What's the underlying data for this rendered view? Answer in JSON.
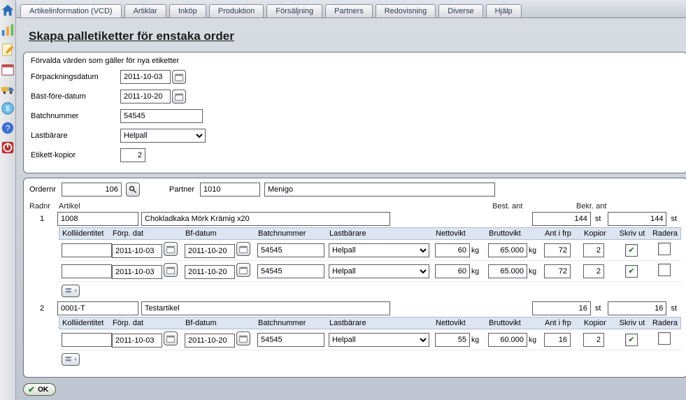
{
  "tabs": [
    "Artikelinformation (VCD)",
    "Artiklar",
    "Inköp",
    "Produktion",
    "Försäljning",
    "Partners",
    "Redovisning",
    "Diverse",
    "Hjälp"
  ],
  "page_title": "Skapa palletiketter för enstaka order",
  "defaults": {
    "caption": "Förvalda värden som gäller för nya etiketter",
    "labels": {
      "forpackningsdatum": "Förpackningsdatum",
      "bast_fore_datum": "Bäst-före-datum",
      "batchnummer": "Batchnummer",
      "lastbarare": "Lastbärare",
      "etikett_kopior": "Etikett-kopior"
    },
    "values": {
      "forpackningsdatum": "2011-10-03",
      "bast_fore_datum": "2011-10-20",
      "batchnummer": "54545",
      "lastbarare": "Helpall",
      "etikett_kopior": "2"
    }
  },
  "order": {
    "labels": {
      "ordernr": "Ordernr",
      "partner": "Partner"
    },
    "ordernr": "106",
    "partner_code": "1010",
    "partner_name": "Menigo"
  },
  "grid": {
    "head": {
      "radnr": "Radnr",
      "artikel": "Artikel",
      "best_ant": "Best. ant",
      "bekr_ant": "Bekr. ant"
    },
    "subhead": {
      "kolliidentitet": "Kolliidentitet",
      "forp_dat": "Förp. dat",
      "bf_datum": "Bf-datum",
      "batchnummer": "Batchnummer",
      "lastbarare": "Lastbärare",
      "nettovikt": "Nettovikt",
      "bruttovikt": "Bruttovikt",
      "ant_i_frp": "Ant i frp",
      "kopior": "Kopior",
      "skriv_ut": "Skriv ut",
      "radera": "Radera"
    },
    "unit_st": "st",
    "unit_kg": "kg",
    "lines": [
      {
        "row": "1",
        "artnr": "1008",
        "artdesc": "Chokladkaka Mörk Krämig x20",
        "best_ant": "144",
        "bekr_ant": "144",
        "subs": [
          {
            "kolli": "",
            "forp": "2011-10-03",
            "bf": "2011-10-20",
            "batch": "54545",
            "last": "Helpall",
            "netto": "60",
            "brutto": "65.000",
            "antfrp": "72",
            "kopior": "2",
            "skriv": true,
            "radera": false
          },
          {
            "kolli": "",
            "forp": "2011-10-03",
            "bf": "2011-10-20",
            "batch": "54545",
            "last": "Helpall",
            "netto": "60",
            "brutto": "65.000",
            "antfrp": "72",
            "kopior": "2",
            "skriv": true,
            "radera": false
          }
        ]
      },
      {
        "row": "2",
        "artnr": "0001-T",
        "artdesc": "Testartikel",
        "best_ant": "16",
        "bekr_ant": "16",
        "subs": [
          {
            "kolli": "",
            "forp": "2011-10-03",
            "bf": "2011-10-20",
            "batch": "54545",
            "last": "Helpall",
            "netto": "55",
            "brutto": "60.000",
            "antfrp": "16",
            "kopior": "2",
            "skriv": true,
            "radera": false
          }
        ]
      }
    ]
  },
  "buttons": {
    "ok": "OK"
  },
  "sidebar_icons": [
    "home-icon",
    "chart-icon",
    "note-icon",
    "calendar-icon",
    "truck-icon",
    "coin-icon",
    "help-icon",
    "power-icon"
  ]
}
